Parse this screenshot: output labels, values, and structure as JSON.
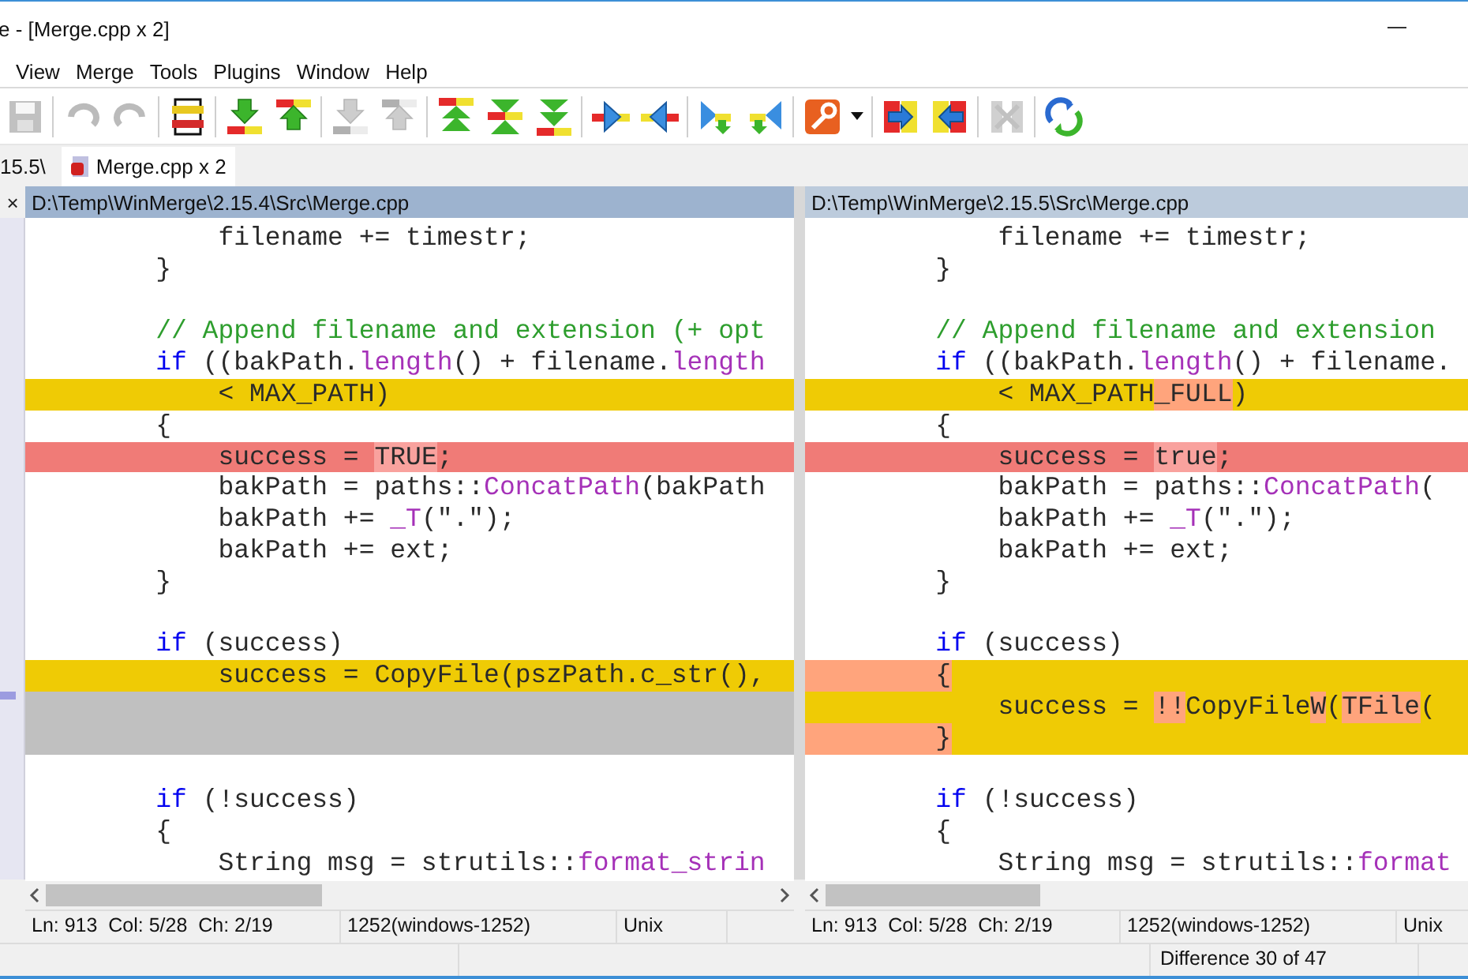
{
  "window": {
    "title": "e - [Merge.cpp x 2]"
  },
  "menu": [
    "View",
    "Merge",
    "Tools",
    "Plugins",
    "Window",
    "Help"
  ],
  "toolbar": [
    {
      "kind": "save",
      "disabled": true
    },
    {
      "kind": "separator"
    },
    {
      "kind": "undo",
      "disabled": true
    },
    {
      "kind": "redo",
      "disabled": true
    },
    {
      "kind": "separator"
    },
    {
      "kind": "eol",
      "disabled": false
    },
    {
      "kind": "separator"
    },
    {
      "kind": "next",
      "disabled": false
    },
    {
      "kind": "prev",
      "disabled": false
    },
    {
      "kind": "separator"
    },
    {
      "kind": "next",
      "disabled": true
    },
    {
      "kind": "prev",
      "disabled": true
    },
    {
      "kind": "separator"
    },
    {
      "kind": "first",
      "disabled": false
    },
    {
      "kind": "current",
      "disabled": false
    },
    {
      "kind": "last",
      "disabled": false
    },
    {
      "kind": "separator"
    },
    {
      "kind": "copy-right",
      "disabled": false
    },
    {
      "kind": "copy-left",
      "disabled": false
    },
    {
      "kind": "separator"
    },
    {
      "kind": "copy-right-advance",
      "disabled": false
    },
    {
      "kind": "copy-left-advance",
      "disabled": false
    },
    {
      "kind": "separator"
    },
    {
      "kind": "options",
      "disabled": false
    },
    {
      "kind": "dropdown",
      "disabled": false
    },
    {
      "kind": "separator"
    },
    {
      "kind": "all-right",
      "disabled": false
    },
    {
      "kind": "all-left",
      "disabled": false
    },
    {
      "kind": "separator"
    },
    {
      "kind": "merge",
      "disabled": true
    },
    {
      "kind": "separator"
    },
    {
      "kind": "refresh",
      "disabled": false
    }
  ],
  "tabs": [
    {
      "label": "15.5\\",
      "selected": false
    },
    {
      "label": "Merge.cpp x 2",
      "selected": true
    }
  ],
  "close_symbol": "×",
  "panes": [
    {
      "path": "D:\\Temp\\WinMerge\\2.15.4\\Src\\Merge.cpp",
      "active": true,
      "lines": [
        {
          "kind": "normal",
          "tokens": [
            {
              "kind": "plain",
              "text": "        filename += timestr;"
            }
          ]
        },
        {
          "kind": "normal",
          "tokens": [
            {
              "kind": "plain",
              "text": "    }"
            }
          ]
        },
        {
          "kind": "blank"
        },
        {
          "kind": "normal",
          "tokens": [
            {
              "kind": "comment",
              "text": "    // Append filename and extension (+ opt"
            }
          ]
        },
        {
          "kind": "normal",
          "tokens": [
            {
              "kind": "keyword",
              "text": "    if"
            },
            {
              "kind": "plain",
              "text": " ((bakPath."
            },
            {
              "kind": "func",
              "text": "length"
            },
            {
              "kind": "plain",
              "text": "() + filename."
            },
            {
              "kind": "func",
              "text": "length"
            }
          ]
        },
        {
          "kind": "changed",
          "tokens": [
            {
              "kind": "plain",
              "text": "        < MAX_PATH)"
            }
          ]
        },
        {
          "kind": "normal",
          "tokens": [
            {
              "kind": "plain",
              "text": "    {"
            }
          ]
        },
        {
          "kind": "removed",
          "tokens": [
            {
              "kind": "plain",
              "text": "        success = "
            },
            {
              "kind": "diff",
              "text": "TRUE"
            },
            {
              "kind": "plain",
              "text": ";"
            }
          ]
        },
        {
          "kind": "normal",
          "tokens": [
            {
              "kind": "plain",
              "text": "        bakPath = paths::"
            },
            {
              "kind": "func",
              "text": "ConcatPath"
            },
            {
              "kind": "plain",
              "text": "(bakPath"
            }
          ]
        },
        {
          "kind": "normal",
          "tokens": [
            {
              "kind": "plain",
              "text": "        bakPath += "
            },
            {
              "kind": "func",
              "text": "_T"
            },
            {
              "kind": "plain",
              "text": "(\".\");"
            }
          ]
        },
        {
          "kind": "normal",
          "tokens": [
            {
              "kind": "plain",
              "text": "        bakPath += ext;"
            }
          ]
        },
        {
          "kind": "normal",
          "tokens": [
            {
              "kind": "plain",
              "text": "    }"
            }
          ]
        },
        {
          "kind": "blank"
        },
        {
          "kind": "normal",
          "tokens": [
            {
              "kind": "keyword",
              "text": "    if"
            },
            {
              "kind": "plain",
              "text": " (success)"
            }
          ]
        },
        {
          "kind": "changed",
          "tokens": [
            {
              "kind": "plain",
              "text": "        success = CopyFile(pszPath.c_str(),"
            }
          ]
        },
        {
          "kind": "ghost"
        },
        {
          "kind": "ghost"
        },
        {
          "kind": "blank"
        },
        {
          "kind": "normal",
          "tokens": [
            {
              "kind": "keyword",
              "text": "    if"
            },
            {
              "kind": "plain",
              "text": " (!success)"
            }
          ]
        },
        {
          "kind": "normal",
          "tokens": [
            {
              "kind": "plain",
              "text": "    {"
            }
          ]
        },
        {
          "kind": "normal",
          "tokens": [
            {
              "kind": "plain",
              "text": "        String msg = strutils::"
            },
            {
              "kind": "func",
              "text": "format_strin"
            }
          ]
        }
      ],
      "status": [
        "Ln: 913  Col: 5/28  Ch: 2/19",
        "1252(windows-1252)",
        "Unix"
      ]
    },
    {
      "path": "D:\\Temp\\WinMerge\\2.15.5\\Src\\Merge.cpp",
      "active": false,
      "lines": [
        {
          "kind": "normal",
          "tokens": [
            {
              "kind": "plain",
              "text": "        filename += timestr;"
            }
          ]
        },
        {
          "kind": "normal",
          "tokens": [
            {
              "kind": "plain",
              "text": "    }"
            }
          ]
        },
        {
          "kind": "blank"
        },
        {
          "kind": "normal",
          "tokens": [
            {
              "kind": "comment",
              "text": "    // Append filename and extension"
            }
          ]
        },
        {
          "kind": "normal",
          "tokens": [
            {
              "kind": "keyword",
              "text": "    if"
            },
            {
              "kind": "plain",
              "text": " ((bakPath."
            },
            {
              "kind": "func",
              "text": "length"
            },
            {
              "kind": "plain",
              "text": "() + filename."
            }
          ]
        },
        {
          "kind": "changed",
          "tokens": [
            {
              "kind": "plain",
              "text": "        < MAX_PATH"
            },
            {
              "kind": "diff",
              "text": "_FULL"
            },
            {
              "kind": "plain",
              "text": ")"
            }
          ]
        },
        {
          "kind": "normal",
          "tokens": [
            {
              "kind": "plain",
              "text": "    {"
            }
          ]
        },
        {
          "kind": "removed",
          "tokens": [
            {
              "kind": "plain",
              "text": "        success = "
            },
            {
              "kind": "diff",
              "text": "true"
            },
            {
              "kind": "plain",
              "text": ";"
            }
          ]
        },
        {
          "kind": "normal",
          "tokens": [
            {
              "kind": "plain",
              "text": "        bakPath = paths::"
            },
            {
              "kind": "func",
              "text": "ConcatPath"
            },
            {
              "kind": "plain",
              "text": "("
            }
          ]
        },
        {
          "kind": "normal",
          "tokens": [
            {
              "kind": "plain",
              "text": "        bakPath += "
            },
            {
              "kind": "func",
              "text": "_T"
            },
            {
              "kind": "plain",
              "text": "(\".\");"
            }
          ]
        },
        {
          "kind": "normal",
          "tokens": [
            {
              "kind": "plain",
              "text": "        bakPath += ext;"
            }
          ]
        },
        {
          "kind": "normal",
          "tokens": [
            {
              "kind": "plain",
              "text": "    }"
            }
          ]
        },
        {
          "kind": "blank"
        },
        {
          "kind": "normal",
          "tokens": [
            {
              "kind": "keyword",
              "text": "    if"
            },
            {
              "kind": "plain",
              "text": " (success)"
            }
          ]
        },
        {
          "kind": "changed",
          "tokens": [
            {
              "kind": "diff",
              "text": "    {"
            }
          ]
        },
        {
          "kind": "changed",
          "tokens": [
            {
              "kind": "plain",
              "text": "        success = "
            },
            {
              "kind": "diff",
              "text": "!!"
            },
            {
              "kind": "plain",
              "text": "CopyFile"
            },
            {
              "kind": "diff",
              "text": "W"
            },
            {
              "kind": "plain",
              "text": "("
            },
            {
              "kind": "diff",
              "text": "TFile"
            },
            {
              "kind": "plain",
              "text": "("
            }
          ]
        },
        {
          "kind": "changed",
          "tokens": [
            {
              "kind": "diff",
              "text": "    }"
            }
          ]
        },
        {
          "kind": "blank"
        },
        {
          "kind": "normal",
          "tokens": [
            {
              "kind": "keyword",
              "text": "    if"
            },
            {
              "kind": "plain",
              "text": " (!success)"
            }
          ]
        },
        {
          "kind": "normal",
          "tokens": [
            {
              "kind": "plain",
              "text": "    {"
            }
          ]
        },
        {
          "kind": "normal",
          "tokens": [
            {
              "kind": "plain",
              "text": "        String msg = strutils::"
            },
            {
              "kind": "func",
              "text": "format"
            }
          ]
        }
      ],
      "status": [
        "Ln: 913  Col: 5/28  Ch: 2/19",
        "1252(windows-1252)",
        "Unix"
      ]
    }
  ],
  "status_bar": {
    "difference": "Difference 30 of 47"
  }
}
